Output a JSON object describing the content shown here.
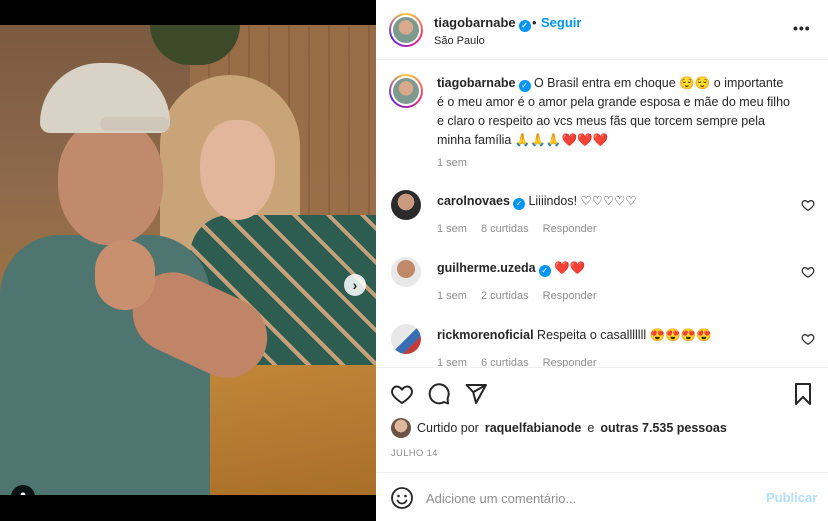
{
  "post": {
    "author": "tiagobarnabe",
    "follow_label": "Seguir",
    "separator": "•",
    "location": "São Paulo",
    "more_label": "•••"
  },
  "caption": {
    "user": "tiagobarnabe",
    "text": " O Brasil entra em choque 😌😌 o importante é o meu amor é o amor pela grande esposa e mãe do meu filho e claro o respeito ao vcs meus fãs que torcem sempre pela minha família 🙏🙏🙏❤️❤️❤️",
    "time": "1 sem"
  },
  "comments": [
    {
      "user": "carolnovaes",
      "text": " Liiiindos! ♡♡♡♡♡",
      "time": "1 sem",
      "likes": "8 curtidas",
      "reply": "Responder"
    },
    {
      "user": "guilherme.uzeda",
      "text": " ❤️❤️",
      "time": "1 sem",
      "likes": "2 curtidas",
      "reply": "Responder"
    },
    {
      "user": "rickmorenoficial",
      "text": " Respeita o casalllllll 😍😍😍😍",
      "time": "1 sem",
      "likes": "6 curtidas",
      "reply": "Responder"
    }
  ],
  "likes": {
    "prefix": "Curtido por",
    "user": "raquelfabianode",
    "middle": "e",
    "others": "outras 7.535 pessoas"
  },
  "date": "JULHO 14",
  "add_comment": {
    "placeholder": "Adicione um comentário...",
    "post_label": "Publicar"
  },
  "carousel": {
    "total": 2,
    "active": 1
  },
  "icons": {
    "like": "heart-icon",
    "comment": "comment-icon",
    "share": "send-icon",
    "save": "bookmark-icon",
    "emoji": "emoji-icon",
    "tag": "user-tag-icon",
    "next": "chevron-right-icon"
  },
  "colors": {
    "accent": "#0095f6",
    "muted": "#8e8e8e",
    "text": "#262626",
    "post_disabled": "#b2dffc"
  }
}
